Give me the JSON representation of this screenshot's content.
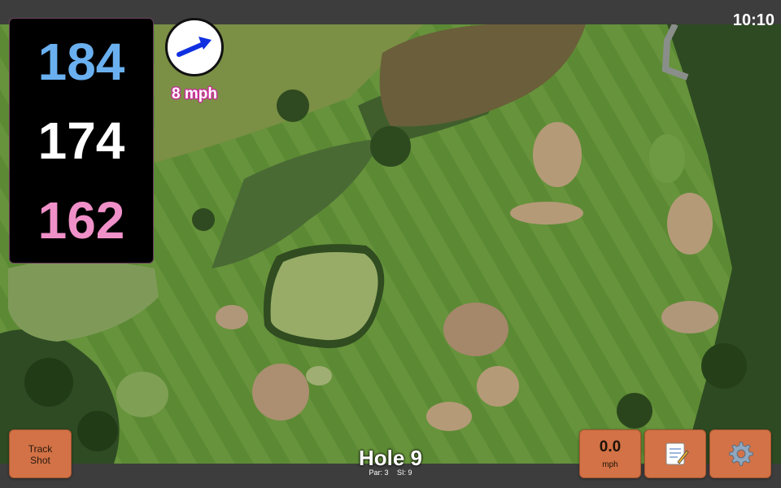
{
  "status_bar": {
    "time": "10:10"
  },
  "distances": {
    "back": "184",
    "middle": "174",
    "front": "162"
  },
  "wind": {
    "speed_label": "8 mph",
    "direction_icon": "arrow-icon"
  },
  "hole": {
    "title": "Hole 9",
    "par": "Par: 3",
    "stroke_index": "SI: 9"
  },
  "buttons": {
    "track_shot": "Track\nShot",
    "speed_value": "0.0",
    "speed_unit": "mph",
    "notes_icon": "notepad-icon",
    "settings_icon": "gear-icon"
  },
  "colors": {
    "back_distance": "#6ab0f0",
    "middle_distance": "#ffffff",
    "front_distance": "#f090c8",
    "button": "#d27246",
    "wind_arrow": "#1030e0",
    "wind_outline": "#c8309a"
  }
}
